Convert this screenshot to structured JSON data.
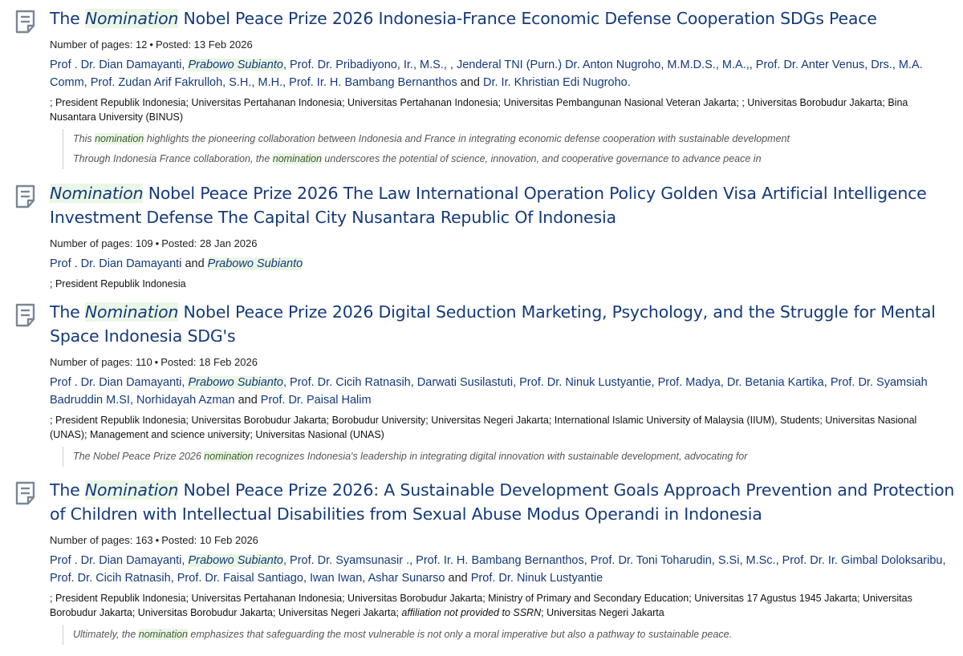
{
  "results": [
    {
      "icon": "document-icon",
      "title_pre": "The ",
      "title_hl": "Nomination",
      "title_post": " Nobel Peace Prize 2026 Indonesia-France Economic Defense Cooperation SDGs Peace",
      "pages_label": "Number of pages: 12",
      "posted_label": "Posted: 13 Feb 2026",
      "authors": [
        "Prof . Dr. Dian Damayanti",
        "Prabowo Subianto",
        "Prof. Dr. Pribadiyono, Ir., M.S., ",
        "Jenderal TNI (Purn.) Dr. Anton Nugroho, M.M.D.S., M.A.,",
        "Prof. Dr. Anter Venus, Drs., M.A. Comm",
        "Prof. Zudan Arif Fakrulloh, S.H., M.H.",
        "Prof. Ir. H. Bambang Bernanthos",
        "Dr. Ir. Khristian Edi Nugroho."
      ],
      "and_word": "and",
      "affiliations": "; President Republik Indonesia; Universitas Pertahanan Indonesia; Universitas Pertahanan Indonesia; Universitas Pembangunan Nasional Veteran Jakarta; ; Universitas Borobudur Jakarta; Bina Nusantara University (BINUS)",
      "snippets": [
        {
          "pre": "This ",
          "hl": "nomination",
          "post": " highlights the pioneering collaboration between Indonesia and France in integrating economic defense cooperation with sustainable development"
        },
        {
          "pre": "Through Indonesia France collaboration, the ",
          "hl": "nomination",
          "post": " underscores the potential of science, innovation, and cooperative governance to advance peace in"
        }
      ]
    },
    {
      "icon": "document-icon",
      "title_pre": "",
      "title_hl": "Nomination",
      "title_post": " Nobel Peace Prize 2026 The Law International Operation Policy Golden Visa Artificial Intelligence Investment Defense The Capital City Nusantara Republic Of Indonesia",
      "pages_label": "Number of pages: 109",
      "posted_label": "Posted: 28 Jan 2026",
      "authors": [
        "Prof . Dr. Dian Damayanti",
        "Prabowo Subianto"
      ],
      "and_word": "and",
      "affiliations": "; President Republik Indonesia",
      "snippets": []
    },
    {
      "icon": "document-icon",
      "title_pre": "The ",
      "title_hl": "Nomination",
      "title_post": " Nobel Peace Prize 2026 Digital Seduction Marketing, Psychology, and the Struggle for Mental Space Indonesia SDG's",
      "pages_label": "Number of pages: 110",
      "posted_label": "Posted: 18 Feb 2026",
      "authors": [
        "Prof . Dr. Dian Damayanti",
        "Prabowo Subianto",
        "Prof. Dr. Cicih Ratnasih",
        "Darwati Susilastuti",
        "Prof. Dr. Ninuk Lustyantie",
        "Prof. Madya",
        "Dr. Betania Kartika",
        "Prof. Dr. Syamsiah Badruddin M.SI",
        "Norhidayah Azman",
        "Prof. Dr. Paisal Halim"
      ],
      "and_word": "and",
      "affiliations": "; President Republik Indonesia; Universitas Borobudur Jakarta; Borobudur University; Universitas Negeri Jakarta; International Islamic University of Malaysia (IIUM), Students; Universitas Nasional (UNAS); Management and science university; Universitas Nasional (UNAS)",
      "snippets": [
        {
          "pre": "The Nobel Peace Prize 2026 ",
          "hl": "nomination",
          "post": " recognizes Indonesia's leadership in integrating digital innovation with sustainable development, advocating for"
        }
      ]
    },
    {
      "icon": "document-icon",
      "title_pre": "The ",
      "title_hl": "Nomination",
      "title_post": " Nobel Peace Prize 2026: A Sustainable Development Goals Approach Prevention and Protection of Children with Intellectual Disabilities from Sexual Abuse Modus Operandi in Indonesia",
      "pages_label": "Number of pages: 163",
      "posted_label": "Posted: 10 Feb 2026",
      "authors": [
        "Prof . Dr. Dian Damayanti",
        "Prabowo Subianto",
        "Prof. Dr. Syamsunasir .",
        "Prof. Ir. H. Bambang Bernanthos",
        "Prof. Dr. Toni Toharudin, S.Si, M.Sc.",
        "Prof. Dr. Ir. Gimbal Doloksaribu",
        "Prof. Dr. Cicih Ratnasih",
        "Prof. Dr. Faisal Santiago",
        "Iwan Iwan",
        "Ashar Sunarso",
        "Prof. Dr. Ninuk Lustyantie"
      ],
      "and_word": "and",
      "affiliations_pre": "; President Republik Indonesia; Universitas Pertahanan Indonesia; Universitas Borobudur Jakarta; Ministry of Primary and Secondary Education; Universitas 17 Agustus 1945 Jakarta; Universitas Borobudur Jakarta; Universitas Borobudur Jakarta; Universitas Negeri Jakarta; ",
      "affiliations_it": "affiliation not provided to SSRN",
      "affiliations_post": "; Universitas Negeri Jakarta",
      "snippets": [
        {
          "pre": "Ultimately, the ",
          "hl": "nomination",
          "post": " emphasizes that safeguarding the most vulnerable is not only a moral imperative but also a pathway to sustainable peace."
        }
      ]
    }
  ],
  "colors": {
    "title": "#143a7a",
    "highlight_bg": "#eaf6e6",
    "icon": "#7a8694"
  }
}
